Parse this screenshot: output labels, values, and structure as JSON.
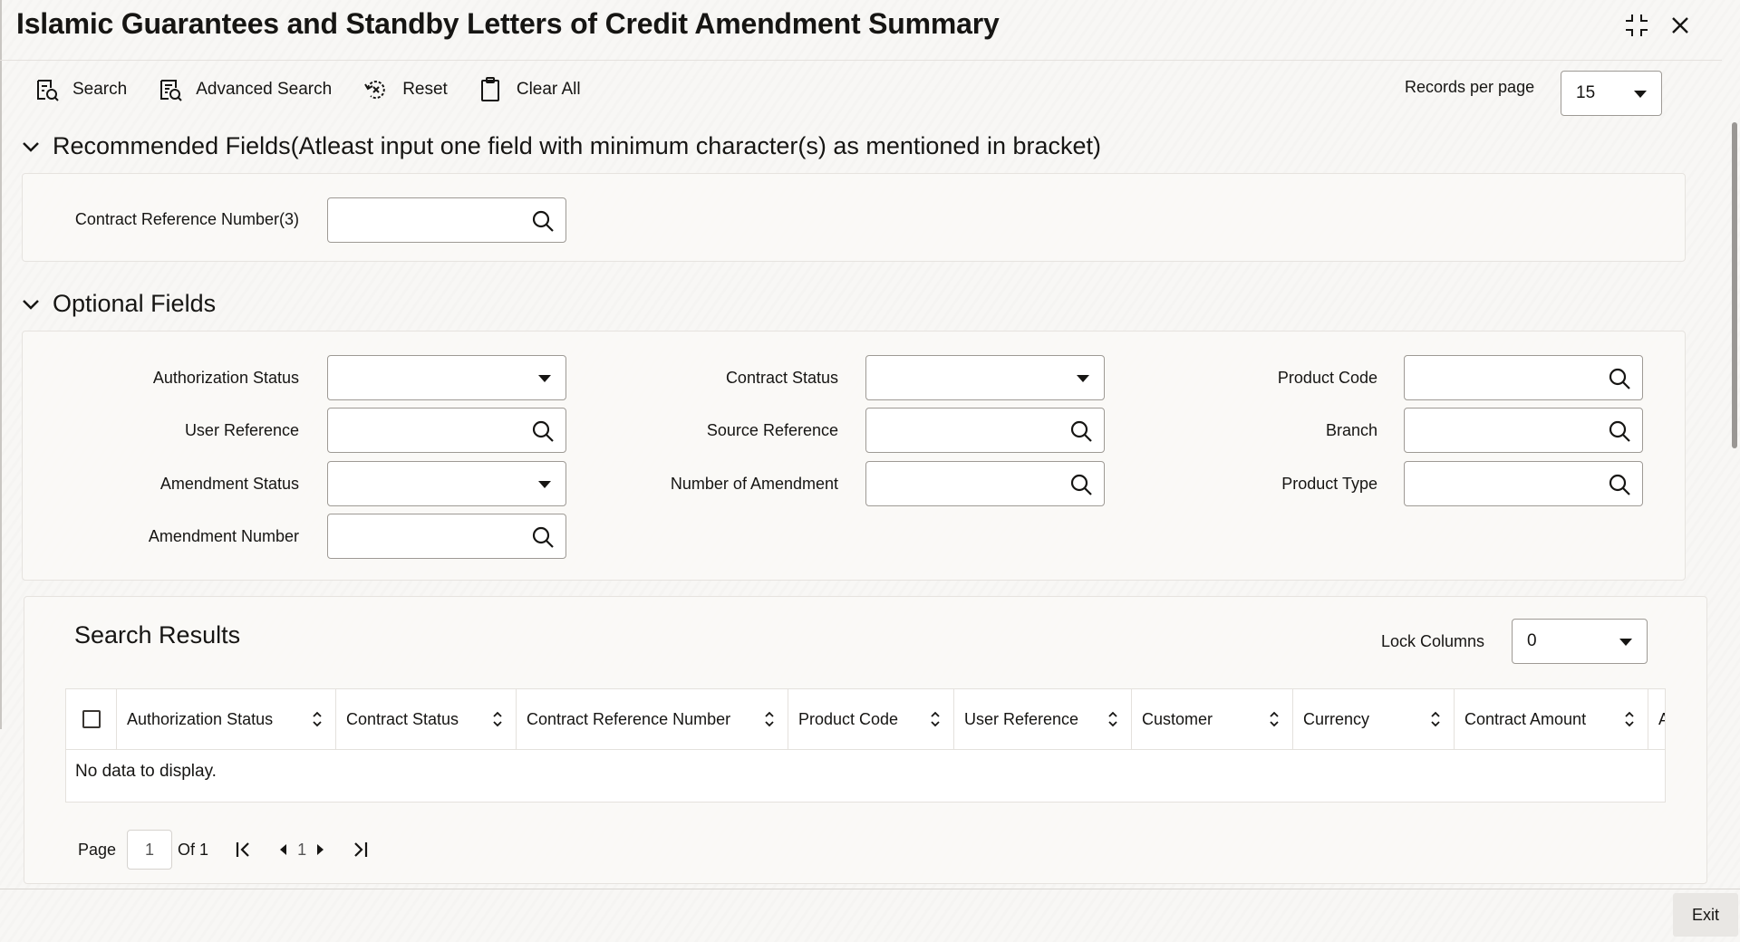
{
  "window": {
    "title": "Islamic Guarantees and Standby Letters of Credit Amendment Summary"
  },
  "toolbar": {
    "search": "Search",
    "advanced_search": "Advanced Search",
    "reset": "Reset",
    "clear_all": "Clear All",
    "records_per_page_label": "Records per page",
    "records_per_page_value": "15"
  },
  "recommended": {
    "heading": "Recommended Fields(Atleast input one field with minimum character(s) as mentioned in bracket)",
    "contract_ref_label": "Contract Reference Number(3)"
  },
  "optional": {
    "heading": "Optional Fields",
    "authorization_status": "Authorization Status",
    "contract_status": "Contract Status",
    "product_code": "Product Code",
    "user_reference": "User Reference",
    "source_reference": "Source Reference",
    "branch": "Branch",
    "amendment_status": "Amendment Status",
    "number_of_amendment": "Number of Amendment",
    "product_type": "Product Type",
    "amendment_number": "Amendment Number"
  },
  "results": {
    "heading": "Search Results",
    "lock_columns_label": "Lock Columns",
    "lock_columns_value": "0",
    "columns": [
      "Authorization Status",
      "Contract Status",
      "Contract Reference Number",
      "Product Code",
      "User Reference",
      "Customer",
      "Currency",
      "Contract Amount",
      "A"
    ],
    "no_data": "No data to display."
  },
  "pager": {
    "page_label": "Page",
    "page_value": "1",
    "of_label": "Of 1",
    "current": "1"
  },
  "footer": {
    "exit": "Exit"
  }
}
